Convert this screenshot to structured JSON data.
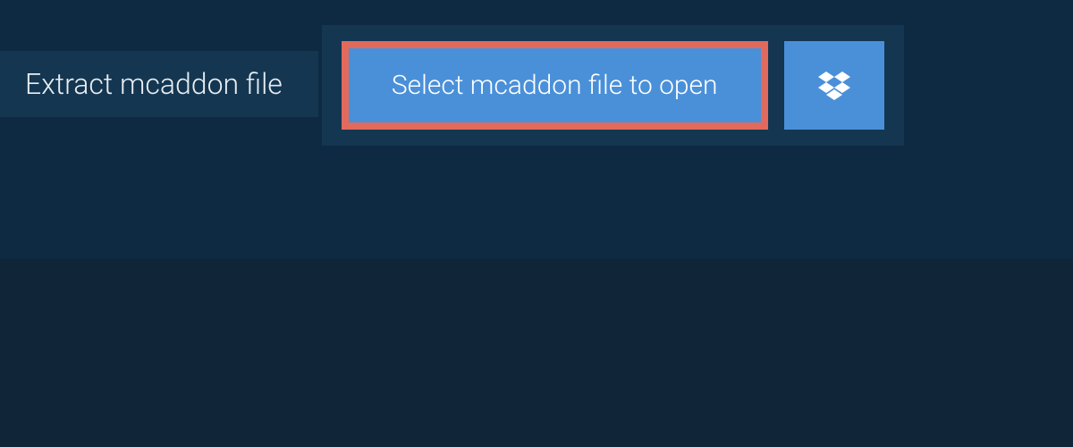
{
  "tab": {
    "label": "Extract mcaddon file"
  },
  "actions": {
    "select_file_label": "Select mcaddon file to open",
    "dropbox_icon": "dropbox"
  },
  "colors": {
    "background": "#0d2a42",
    "panel": "#143651",
    "button": "#4a90d9",
    "highlight_border": "#e26a5c",
    "text_light": "#e8eef3"
  }
}
